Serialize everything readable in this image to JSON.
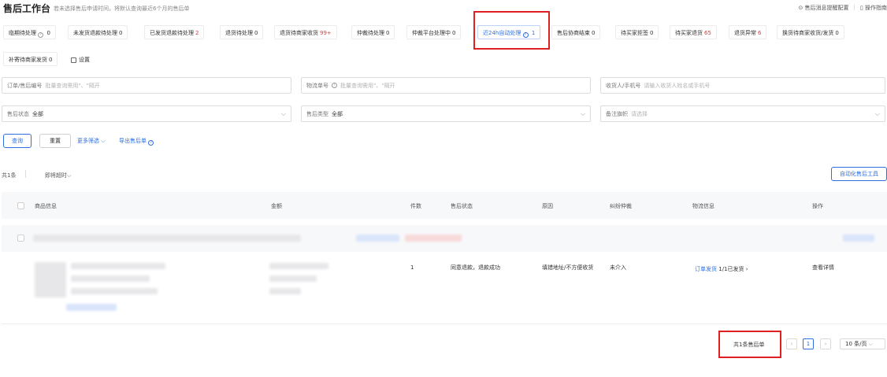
{
  "header": {
    "title": "售后工作台",
    "subtitle": "若未选择售后申请时间，将默认查询最近6个月的售后单",
    "links": [
      "售后消息提醒配置",
      "操作指南"
    ]
  },
  "tabs": [
    {
      "label": "临期待处理",
      "count": "0",
      "info": true
    },
    {
      "label": "未发货退款待处理",
      "count": "0"
    },
    {
      "label": "已发货退款待处理",
      "count": "2",
      "red": true
    },
    {
      "label": "退货待处理",
      "count": "0"
    },
    {
      "label": "退货待商家收货",
      "count": "99+",
      "red": true
    },
    {
      "label": "仲裁待处理",
      "count": "0"
    },
    {
      "label": "仲裁平台处理中",
      "count": "0"
    },
    {
      "label": "近24h自动处理",
      "count": "1",
      "info": true,
      "active": true
    },
    {
      "label": "售后协商结束",
      "count": "0"
    },
    {
      "label": "待买家拒签",
      "count": "0"
    },
    {
      "label": "待买家退货",
      "count": "65",
      "red": true
    },
    {
      "label": "退货异常",
      "count": "6",
      "red": true
    },
    {
      "label": "换货待商家收货/发货",
      "count": "0"
    },
    {
      "label": "补寄待商家发货",
      "count": "0"
    }
  ],
  "settings_label": "设置",
  "filters": {
    "order_label": "订单/售后编号",
    "order_placeholder": "批量查询需用\"、\"隔开",
    "logistics_label": "物流单号",
    "logistics_placeholder": "批量查询需用\"、\"隔开",
    "receiver_label": "收货人/手机号",
    "receiver_placeholder": "请输入收货人姓名或手机号",
    "status_label": "售后状态",
    "status_value": "全部",
    "type_label": "售后类型",
    "type_value": "全部",
    "flag_label": "备注旗帜",
    "flag_placeholder": "请选择"
  },
  "actions": {
    "query": "查询",
    "reset": "重置",
    "more_filters": "更多筛选",
    "export": "导出售后单"
  },
  "summary": {
    "total": "共1条",
    "sort": "即将超时",
    "auto_tool": "自动化售后工具"
  },
  "table": {
    "headers": [
      "商品信息",
      "金额",
      "件数",
      "售后状态",
      "原因",
      "纠纷仲裁",
      "物流信息",
      "操作"
    ],
    "row": {
      "qty": "1",
      "status": "同意退款，退款成功",
      "reason": "填错地址/不方便收货",
      "dispute": "未介入",
      "logistics_link": "订单发货",
      "logistics_status": "1/1已发货",
      "action": "查看详情"
    }
  },
  "pagination": {
    "total": "共1条售后单",
    "current_page": "1",
    "page_size": "10 条/页"
  },
  "colors": {
    "accent": "#2f6fe0",
    "alert": "#e4393c",
    "highlight": "#e02020"
  }
}
